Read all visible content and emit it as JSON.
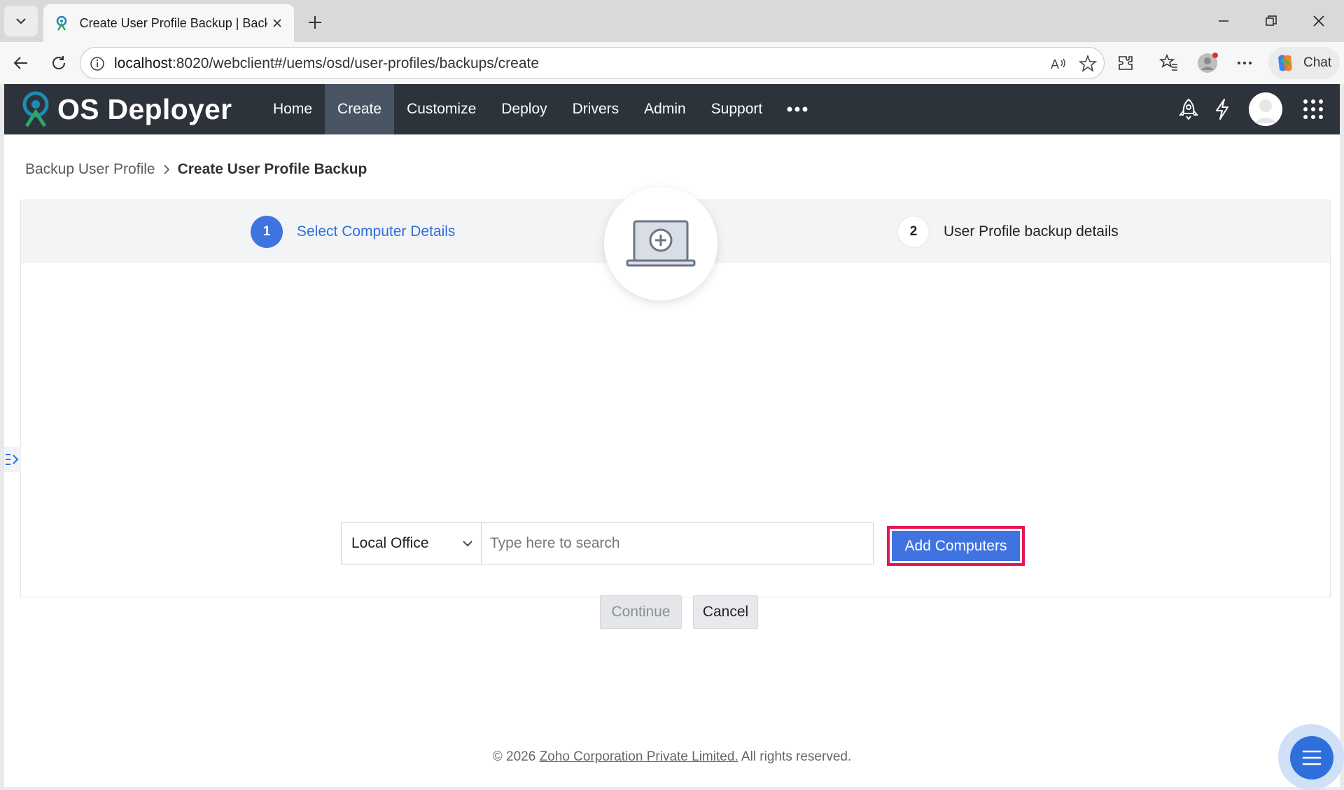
{
  "browser": {
    "tab_title": "Create User Profile Backup | Backup User Profile",
    "url_host": "localhost",
    "url_path": ":8020/webclient#/uems/osd/user-profiles/backups/create",
    "chat_label": "Chat"
  },
  "header": {
    "logo_text": "OS Deployer",
    "nav": [
      "Home",
      "Create",
      "Customize",
      "Deploy",
      "Drivers",
      "Admin",
      "Support"
    ],
    "active_nav": "Create"
  },
  "breadcrumb": {
    "parent": "Backup User Profile",
    "current": "Create User Profile Backup"
  },
  "steps": [
    {
      "number": "1",
      "label": "Select Computer Details",
      "state": "active"
    },
    {
      "number": "2",
      "label": "User Profile backup details",
      "state": "inactive"
    }
  ],
  "form": {
    "office_selected": "Local Office",
    "search_placeholder": "Type here to search",
    "add_button": "Add Computers",
    "continue_button": "Continue",
    "cancel_button": "Cancel"
  },
  "footer": {
    "prefix": "© 2026 ",
    "company_link": "Zoho Corporation Private Limited.",
    "suffix": " All rights reserved."
  },
  "colors": {
    "header_bg": "#2d333b",
    "accent": "#3f74e0",
    "highlight_border": "#e8135a"
  }
}
